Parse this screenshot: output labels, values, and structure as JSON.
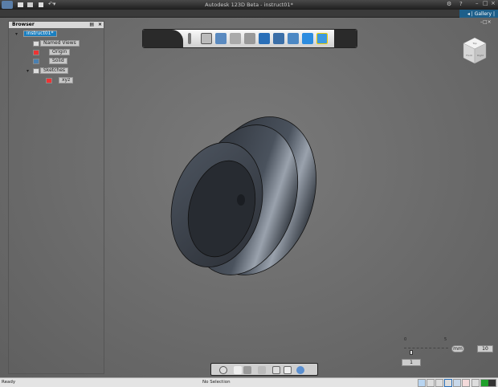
{
  "window": {
    "title": "Autodesk 123D Beta - instruct01*"
  },
  "ribbon": {
    "gallery_label": "Gallery"
  },
  "browser": {
    "title": "Browser",
    "root": "instruct01*",
    "nodes": [
      {
        "label": "Named Views",
        "icon": "views-icon"
      },
      {
        "label": "Origin",
        "icon": "origin-icon"
      },
      {
        "label": "Solid",
        "icon": "solid-icon"
      },
      {
        "label": "Sketches",
        "icon": "folder-icon"
      },
      {
        "label": "xyz",
        "icon": "sketch-icon"
      }
    ]
  },
  "toolbar": {
    "icons": [
      "pencil-icon",
      "primitive-box-icon",
      "extrude-icon",
      "transform-icon",
      "modify-icon",
      "combine-icon",
      "pattern-icon",
      "group-icon",
      "3d-text-icon",
      "snap-icon"
    ]
  },
  "viewcube": {
    "faces": [
      "Top",
      "Front",
      "Right"
    ]
  },
  "scale": {
    "unit": "mm",
    "value": "10",
    "step": "1",
    "tick_left": "0",
    "tick_right": "5"
  },
  "navbar": {
    "icons": [
      "orbit-icon",
      "pan-icon",
      "zoom-icon",
      "look-at-icon",
      "fit-icon",
      "views-icon",
      "display-icon"
    ]
  },
  "status": {
    "left": "Ready",
    "center": "No Selection"
  },
  "colors": {
    "accent": "#1a7fc0",
    "part": "#3c424c"
  }
}
